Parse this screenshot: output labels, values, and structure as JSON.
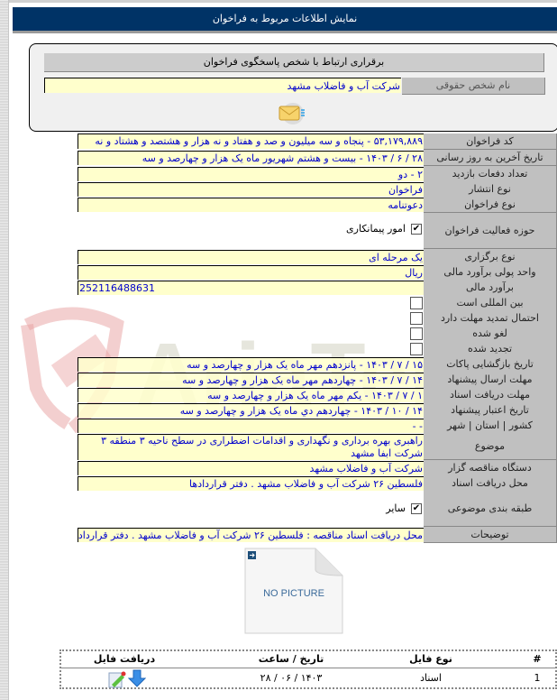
{
  "page": {
    "title": "نمایش اطلاعات مربوط به فراخوان"
  },
  "contact": {
    "title": "برقراری ارتباط با شخص پاسخگوی فراخوان",
    "label": "نام شخص حقوقی",
    "value": "شرکت آب و فاضلاب مشهد",
    "icon": "mail-icon"
  },
  "fields": {
    "code": {
      "label": "کد فراخوان",
      "value": "۵۳,۱۷۹,۸۸۹ - پنجاه و سه میلیون و صد و هفتاد و نه هزار و هشتصد و هشتاد و نه"
    },
    "last_update": {
      "label": "تاریخ آخرین به روز رسانی",
      "value": "۲۸ / ۶ / ۱۴۰۳ - بیست و هشتم شهریور ماه یک هزار و چهارصد و سه"
    },
    "visits": {
      "label": "تعداد دفعات بازدید",
      "value": "۲ - دو"
    },
    "publish_type": {
      "label": "نوع انتشار",
      "value": "فراخوان"
    },
    "call_type": {
      "label": "نوع فراخوان",
      "value": "دعوتنامه"
    },
    "activity_scope": {
      "label": "حوزه فعالیت فراخوان",
      "option": "امور پیمانکاری",
      "checked": true
    },
    "holding_type": {
      "label": "نوع برگزاری",
      "value": "یک مرحله ای"
    },
    "currency": {
      "label": "واحد پولی برآورد مالی",
      "value": "ریال"
    },
    "estimate": {
      "label": "برآورد مالی",
      "value": "252116488631"
    },
    "international": {
      "label": "بین المللی است",
      "checked": false
    },
    "extension": {
      "label": "احتمال تمدید مهلت دارد",
      "checked": false
    },
    "cancelled": {
      "label": "لغو شده",
      "checked": false
    },
    "renewed": {
      "label": "تجدید شده",
      "checked": false
    },
    "opening_date": {
      "label": "تاریخ بازگشایی پاکات",
      "value": "۱۵ / ۷ / ۱۴۰۳ - پانزدهم مهر ماه یک هزار و چهارصد و سه"
    },
    "submit_deadline": {
      "label": "مهلت ارسال پیشنهاد",
      "value": "۱۴ / ۷ / ۱۴۰۳ - چهاردهم مهر ماه یک هزار و چهارصد و سه"
    },
    "docs_deadline": {
      "label": "مهلت دریافت اسناد",
      "value": "۱ / ۷ / ۱۴۰۳ - یکم مهر ماه یک هزار و چهارصد و سه"
    },
    "validity_date": {
      "label": "تاریخ اعتبار پیشنهاد",
      "value": "۱۴ / ۱۰ / ۱۴۰۳ - چهاردهم دي ماه یک هزار و چهارصد و سه"
    },
    "location": {
      "label": "کشور | استان | شهر",
      "value": "- -"
    },
    "subject": {
      "label": "موضوع",
      "value": "راهبری بهره برداری و نگهداری و اقدامات اضطراری در سطح ناحیه ۳ منطقه ۳ شرکت ابفا مشهد"
    },
    "organizer": {
      "label": "دستگاه مناقصه گزار",
      "value": "شرکت آب و فاضلاب مشهد"
    },
    "docs_place": {
      "label": "محل دریافت اسناد",
      "value": "فلسطین ۲۶ شرکت آب و فاضلاب مشهد . دفتر قراردادها"
    },
    "category": {
      "label": "طبقه بندی موضوعی",
      "option": "سایر",
      "checked": true
    },
    "description": {
      "label": "توضیحات",
      "value": "محل دریافت اسناد مناقصه : فلسطین ۲۶ شرکت آب و فاضلاب مشهد . دفتر قراردادها"
    }
  },
  "image": {
    "placeholder": "NO PICTURE"
  },
  "watermark": {
    "text": "AriaTender.net"
  },
  "files": {
    "headers": {
      "index": "#",
      "type": "نوع فایل",
      "date": "تاریخ / ساعت",
      "download": "دریافت فایل"
    },
    "rows": [
      {
        "index": "1",
        "type": "اسناد",
        "date": "۲۸ / ۰۶ / ۱۴۰۳"
      }
    ]
  },
  "colors": {
    "header_bg": "#003366",
    "label_bg": "#c0c0c0",
    "value_bg": "#ffffcc",
    "value_text": "#0000cc"
  }
}
